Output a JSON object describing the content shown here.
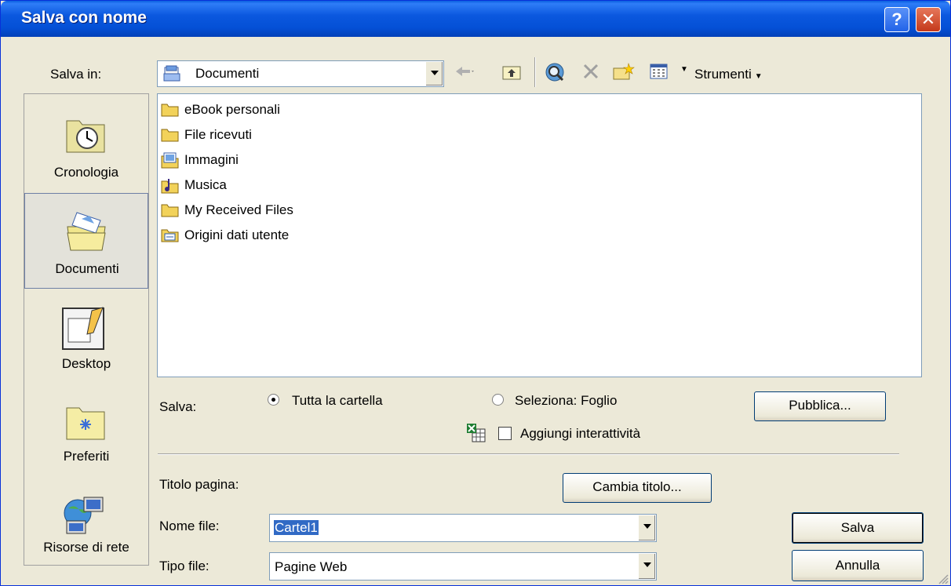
{
  "window": {
    "title": "Salva con nome",
    "help_glyph": "?",
    "close_glyph": "✕"
  },
  "save_in": {
    "label": "Salva in:",
    "value": "Documenti"
  },
  "toolbar": {
    "tools_label": "Strumenti"
  },
  "places": [
    {
      "label": "Cronologia",
      "icon": "history-icon"
    },
    {
      "label": "Documenti",
      "icon": "my-documents-icon",
      "selected": true
    },
    {
      "label": "Desktop",
      "icon": "desktop-icon"
    },
    {
      "label": "Preferiti",
      "icon": "favorites-icon"
    },
    {
      "label": "Risorse di rete",
      "icon": "network-places-icon"
    }
  ],
  "files": [
    {
      "name": "eBook personali",
      "icon": "folder-icon"
    },
    {
      "name": "File ricevuti",
      "icon": "folder-icon"
    },
    {
      "name": "Immagini",
      "icon": "pictures-folder-icon"
    },
    {
      "name": "Musica",
      "icon": "music-folder-icon"
    },
    {
      "name": "My Received Files",
      "icon": "folder-icon"
    },
    {
      "name": "Origini dati utente",
      "icon": "data-sources-folder-icon"
    }
  ],
  "save_options": {
    "label": "Salva:",
    "option_whole": "Tutta la cartella",
    "option_selection": "Seleziona: Foglio",
    "interactivity": "Aggiungi interattività",
    "publish_button": "Pubblica..."
  },
  "page_title": {
    "label": "Titolo pagina:",
    "change_button": "Cambia titolo..."
  },
  "file_name": {
    "label": "Nome file:",
    "value": "Cartel1"
  },
  "file_type": {
    "label": "Tipo file:",
    "value": "Pagine Web"
  },
  "buttons": {
    "save": "Salva",
    "cancel": "Annulla"
  }
}
